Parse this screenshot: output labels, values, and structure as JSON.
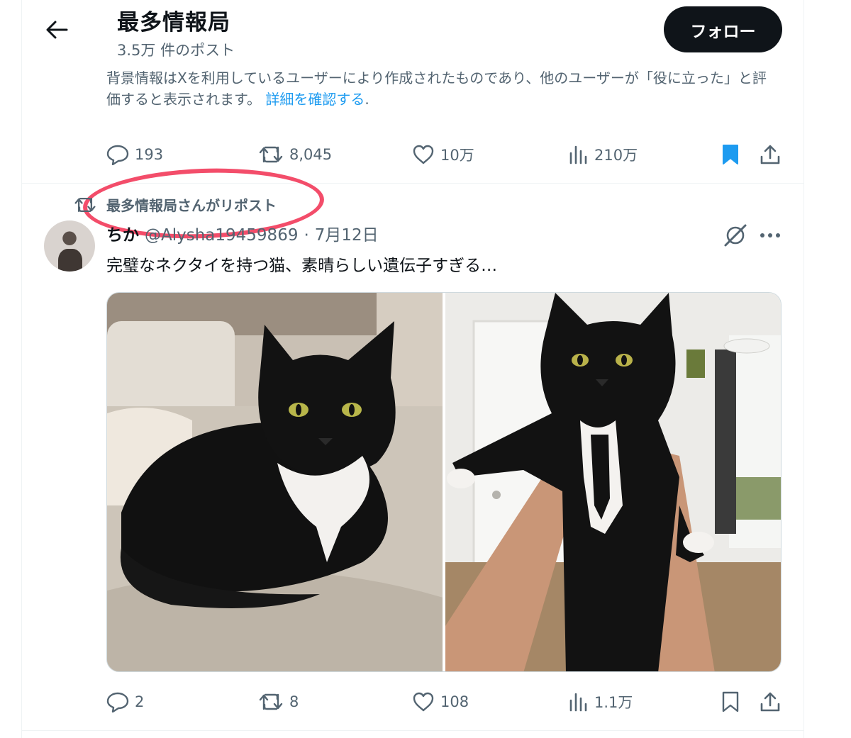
{
  "header": {
    "title": "最多情報局",
    "post_count": "3.5万 件のポスト",
    "follow_label": "フォロー"
  },
  "note": {
    "text": "背景情報はXを利用しているユーザーにより作成されたものであり、他のユーザーが「役に立った」と評価すると表示されます。",
    "link": "詳細を確認する",
    "suffix": "."
  },
  "top_actions": {
    "replies": "193",
    "reposts": "8,045",
    "likes": "10万",
    "views": "210万"
  },
  "repost_banner": "最多情報局さんがリポスト",
  "post": {
    "author_name": "ちか",
    "author_handle": "@Alysha19459869",
    "separator": "·",
    "date": "7月12日",
    "text": "完璧なネクタイを持つ猫、素晴らしい遺伝子すぎる…",
    "actions": {
      "replies": "2",
      "reposts": "8",
      "likes": "108",
      "views": "1.1万"
    }
  },
  "colors": {
    "accent": "#1d9bf0",
    "muted": "#536471",
    "annotation": "#f23a5a"
  }
}
